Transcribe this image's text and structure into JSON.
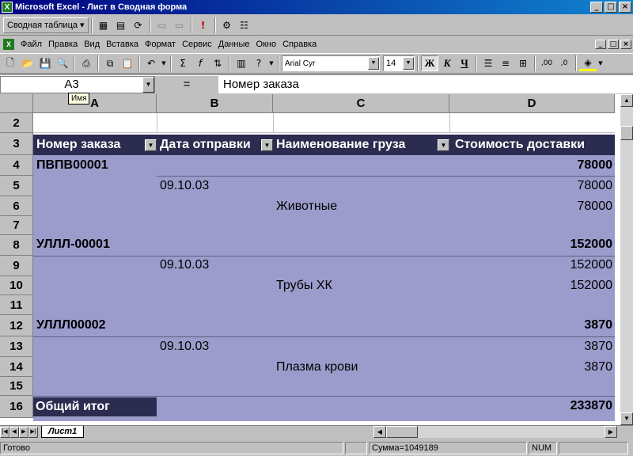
{
  "window": {
    "title": "Microsoft Excel - Лист в Сводная форма",
    "app_icon_text": "X",
    "min": "_",
    "max": "□",
    "close": "×"
  },
  "pivot_toolbar": {
    "menu_label": "Сводная таблица ▾"
  },
  "menubar": {
    "items": [
      "Файл",
      "Правка",
      "Вид",
      "Вставка",
      "Формат",
      "Сервис",
      "Данные",
      "Окно",
      "Справка"
    ]
  },
  "formatting": {
    "font": "Arial Cyr",
    "size": "14",
    "bold": "Ж",
    "italic": "К",
    "underline": "Ч"
  },
  "formula_bar": {
    "name_box": "A3",
    "equals": "=",
    "content": "Номер заказа",
    "name_tooltip": "Имя"
  },
  "columns": [
    "A",
    "B",
    "C",
    "D"
  ],
  "rows": [
    "2",
    "3",
    "4",
    "5",
    "6",
    "7",
    "8",
    "9",
    "10",
    "11",
    "12",
    "13",
    "14",
    "15",
    "16"
  ],
  "pivot": {
    "headers": [
      "Номер заказа",
      "Дата отправки",
      "Наименование груза",
      "Стоимость доставки"
    ],
    "orders": [
      {
        "id": "ПВПВ00001",
        "total": "78000",
        "date": "09.10.03",
        "date_value": "78000",
        "cargo": "Животные",
        "cargo_value": "78000"
      },
      {
        "id": "УЛЛЛ-00001",
        "total": "152000",
        "date": "09.10.03",
        "date_value": "152000",
        "cargo": "Трубы ХК",
        "cargo_value": "152000"
      },
      {
        "id": "УЛЛЛ00002",
        "total": "3870",
        "date": "09.10.03",
        "date_value": "3870",
        "cargo": "Плазма крови",
        "cargo_value": "3870"
      }
    ],
    "grand_total_label": "Общий итог",
    "grand_total": "233870"
  },
  "sheet_tab": "Лист1",
  "status": {
    "ready": "Готово",
    "sum": "Сумма=1049189",
    "num": "NUM"
  }
}
